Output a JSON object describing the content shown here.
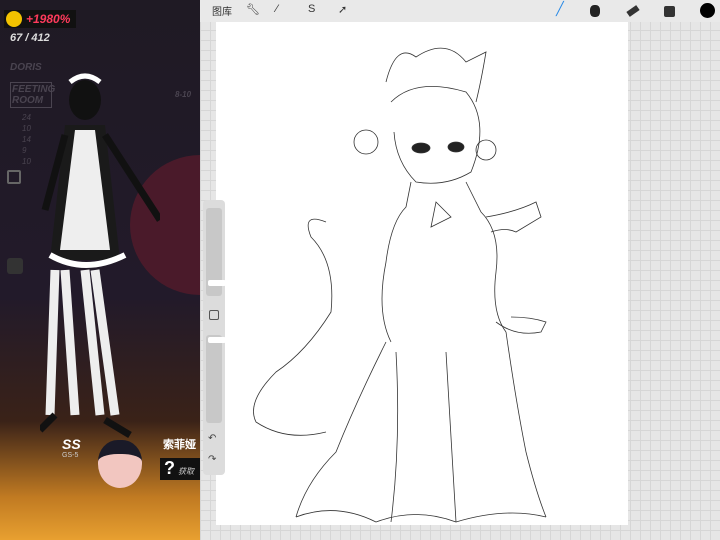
{
  "game": {
    "bonus": "+1980%",
    "progress": "67 / 412",
    "name_tag": "DORIS",
    "room_tag": "FEETING ROOM",
    "range": "8-10",
    "stats": [
      "24",
      "10",
      "14",
      "9",
      "10"
    ],
    "rank": "SS",
    "rank_sub": "GS-5",
    "item_name": "索菲娅",
    "unknown_mark": "?",
    "obtain_label": "获取"
  },
  "procreate": {
    "gallery_label": "图库",
    "tools": [
      "wrench-icon",
      "magic-wand-icon",
      "selection-icon",
      "transform-icon",
      "brush-icon",
      "smudge-icon",
      "eraser-icon",
      "layers-icon",
      "color-icon"
    ],
    "active_tool": "brush",
    "accent": "#2a8ae6",
    "current_color": "#000000"
  }
}
